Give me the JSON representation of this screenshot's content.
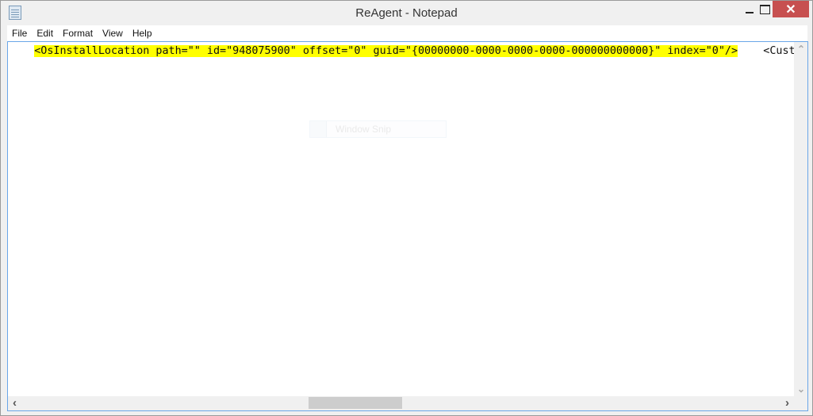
{
  "window": {
    "title": "ReAgent - Notepad",
    "close_glyph": "✕"
  },
  "menu": [
    "File",
    "Edit",
    "Format",
    "View",
    "Help"
  ],
  "editor": {
    "highlighted_text": "<OsInstallLocation path=\"\" id=\"948075900\" offset=\"0\" guid=\"{00000000-0000-0000-0000-000000000000}\" index=\"0\"/>",
    "trailing_text": "    <Cust",
    "indent": "    ",
    "highlight_color": "#ffff00"
  },
  "overlay": {
    "label": "Window Snip"
  },
  "scrollbars": {
    "up": "⌃",
    "down": "⌄",
    "left": "‹",
    "right": "›"
  }
}
